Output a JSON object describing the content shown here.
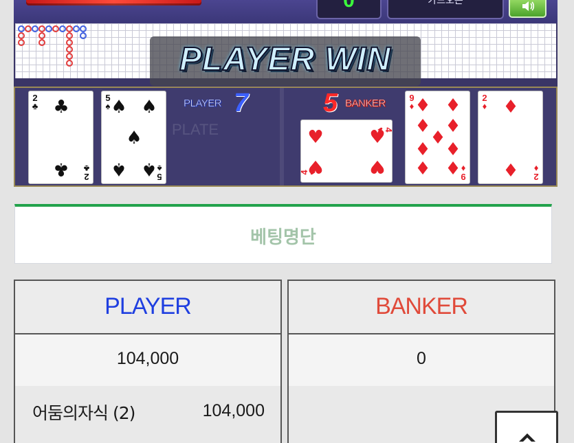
{
  "game": {
    "count_value": "0",
    "mode_label": "카드오픈",
    "result_banner": "PLAYER WIN",
    "table_watermark": "PLATE",
    "player": {
      "label": "PLAYER",
      "score": "7",
      "cards": [
        {
          "rank": "2",
          "suit": "♣",
          "color": "#111111"
        },
        {
          "rank": "5",
          "suit": "♠",
          "color": "#111111"
        }
      ]
    },
    "banker": {
      "label": "BANKER",
      "score": "5",
      "cards": [
        {
          "rank": "4",
          "suit": "♥",
          "color": "#e8202a",
          "orientation": "sideways"
        },
        {
          "rank": "9",
          "suit": "♦",
          "color": "#e8202a"
        },
        {
          "rank": "2",
          "suit": "♦",
          "color": "#e8202a"
        }
      ]
    }
  },
  "betting": {
    "title": "베팅명단",
    "player": {
      "header": "PLAYER",
      "header_color": "#1f3fe0",
      "total": "104,000",
      "bets": [
        {
          "name": "어둠의자식 (2)",
          "amount": "104,000"
        }
      ]
    },
    "banker": {
      "header": "BANKER",
      "header_color": "#e04a3a",
      "total": "0",
      "bets": []
    }
  },
  "icons": {
    "sound": "speaker-icon",
    "scroll_top": "arrow-up-icon"
  }
}
